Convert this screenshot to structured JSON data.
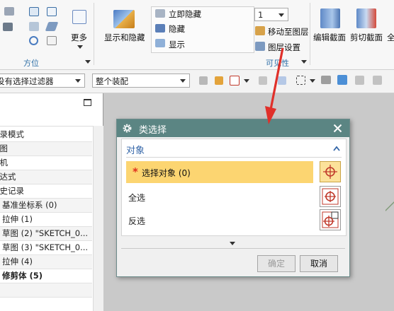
{
  "ribbon": {
    "orient_group_label": "方位",
    "more_label": "更多",
    "show_hide_label": "显示和隐藏",
    "immediate_hide_label": "立即隐藏",
    "hide_label": "隐藏",
    "show_label": "显示",
    "layer_value": "1",
    "move_to_layer_label": "移动至图层",
    "layer_settings_label": "图层设置",
    "visibility_group_label": "可见性",
    "edit_section_label": "编辑截面",
    "clip_section_label": "剪切截面",
    "truncated_label": "全"
  },
  "toolbar": {
    "filter_value": "没有选择过滤器",
    "scope_value": "整个装配"
  },
  "nav": {
    "rows": [
      "记录模式",
      "视图",
      "像机",
      "表达式",
      "历史记录",
      "基准坐标系 (0)",
      "拉伸 (1)",
      "草图 (2) \"SKETCH_0...",
      "草图 (3) \"SKETCH_0...",
      "拉伸 (4)",
      "修剪体 (5)"
    ]
  },
  "dialog": {
    "title": "类选择",
    "section_title": "对象",
    "required_mark": "*",
    "select_objects_label": "选择对象 (0)",
    "select_all_label": "全选",
    "invert_label": "反选",
    "ok_label": "确定",
    "cancel_label": "取消"
  },
  "colors": {
    "dialog_title_bar": "#5b8583",
    "selection_highlight": "#fcd571",
    "required_star": "#e0301e",
    "crosshair": "#c0392b",
    "annotation_arrow": "#e0302a",
    "group_label": "#2f6fa7"
  }
}
